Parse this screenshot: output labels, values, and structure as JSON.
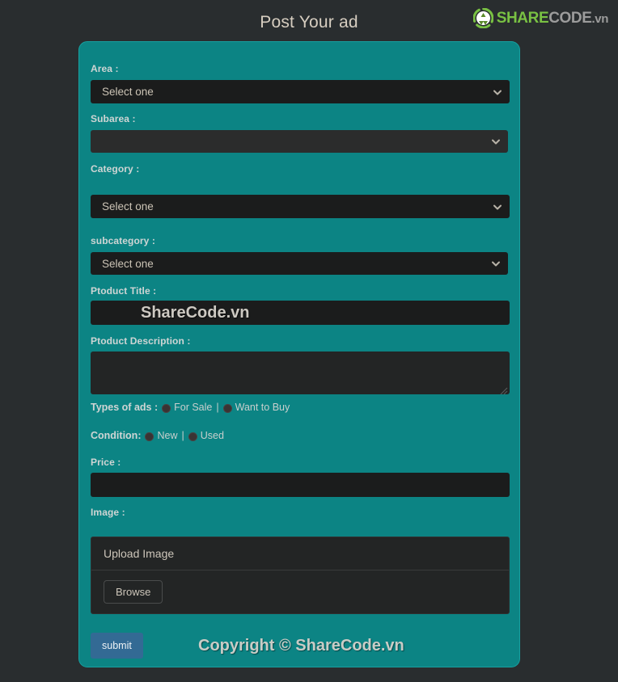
{
  "header": {
    "title": "Post Your ad",
    "logo": {
      "icon": "recycle-circle-icon",
      "share": "SHARE",
      "code": "CODE",
      "tld": ".vn",
      "share_color": "#79c143",
      "code_color": "#9c9c9c"
    }
  },
  "theme": {
    "page_background": "#292d2f",
    "panel_background": "#0c8484",
    "panel_border": "#17a0a0",
    "input_background": "#1b1c1c",
    "label_color": "#cfd5d4",
    "submit_color": "#336a94"
  },
  "form": {
    "fields": {
      "area": {
        "label": "Area :",
        "value": "Select one",
        "icon": "chevron-down-icon"
      },
      "subarea": {
        "label": "Subarea :",
        "value": "",
        "icon": "chevron-down-icon"
      },
      "category": {
        "label": "Category :",
        "value": "Select one",
        "icon": "chevron-down-icon"
      },
      "subcategory": {
        "label": "subcategory :",
        "value": "Select one",
        "icon": "chevron-down-icon"
      },
      "product_title": {
        "label": "Ptoduct Title :",
        "value": "",
        "watermark": "ShareCode.vn"
      },
      "product_description": {
        "label": "Ptoduct Description :",
        "value": ""
      },
      "price": {
        "label": "Price :",
        "value": ""
      },
      "image": {
        "label": "Image :"
      }
    },
    "types_of_ads": {
      "label": "Types of ads :",
      "separator": "|",
      "options": [
        {
          "label": "For Sale",
          "selected": false
        },
        {
          "label": "Want to Buy",
          "selected": false
        }
      ]
    },
    "condition": {
      "label": "Condition:",
      "separator": "|",
      "options": [
        {
          "label": "New",
          "selected": false
        },
        {
          "label": "Used",
          "selected": false
        }
      ]
    },
    "upload": {
      "heading": "Upload Image",
      "browse_label": "Browse"
    },
    "submit_label": "submit"
  },
  "footer": {
    "copyright": "Copyright © ShareCode.vn"
  }
}
